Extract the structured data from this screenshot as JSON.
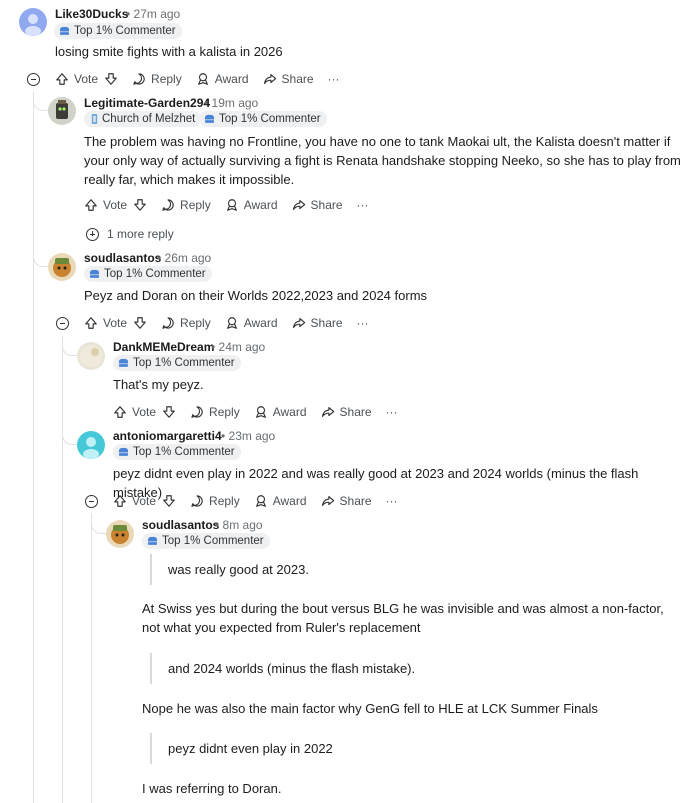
{
  "actions": {
    "vote": "Vote",
    "reply": "Reply",
    "award": "Award",
    "share": "Share",
    "more": "···"
  },
  "comments": [
    {
      "username": "Like30Ducks",
      "time": "• 27m ago",
      "flairs": [
        "Top 1% Commenter"
      ],
      "body": "losing smite fights with a kalista in 2026"
    },
    {
      "username": "Legitimate-Garden294",
      "time": "• 19m ago",
      "flairs": [
        "Church of Melzhet",
        "Top 1% Commenter"
      ],
      "body": "The problem was having no Frontline, you have no one to tank Maokai ult, the Kalista doesn't matter if your only way of actually surviving a fight is Renata handshake stopping Neeko, so she has to play from really far, which makes it impossible.",
      "more_replies": "1 more reply"
    },
    {
      "username": "soudlasantos",
      "time": "• 26m ago",
      "flairs": [
        "Top 1% Commenter"
      ],
      "body": "Peyz and Doran on their Worlds 2022,2023 and 2024 forms"
    },
    {
      "username": "DankMEMeDream",
      "time": "• 24m ago",
      "flairs": [
        "Top 1% Commenter"
      ],
      "body": "That's my peyz."
    },
    {
      "username": "antoniomargaretti4",
      "time": "• 23m ago",
      "flairs": [
        "Top 1% Commenter"
      ],
      "body": "peyz didnt even play in 2022 and was really good at 2023 and 2024 worlds (minus the flash mistake)"
    },
    {
      "username": "soudlasantos",
      "time": "• 8m ago",
      "flairs": [
        "Top 1% Commenter"
      ],
      "quote1": "was really good at 2023.",
      "para1": "At Swiss yes but during the bout versus BLG he was invisible and was almost a non-factor, not what you expected from Ruler's replacement",
      "quote2": "and 2024 worlds (minus the flash mistake).",
      "para2": "Nope he was also the main factor why GenG fell to HLE at LCK Summer Finals",
      "quote3": "peyz didnt even play in 2022",
      "para3": "I was referring to Doran."
    }
  ],
  "colors": {
    "meta": "#6a6e72",
    "thread": "#dfe1e3",
    "flair_bg": "#eef0f2",
    "shield": "#4b84d6"
  }
}
